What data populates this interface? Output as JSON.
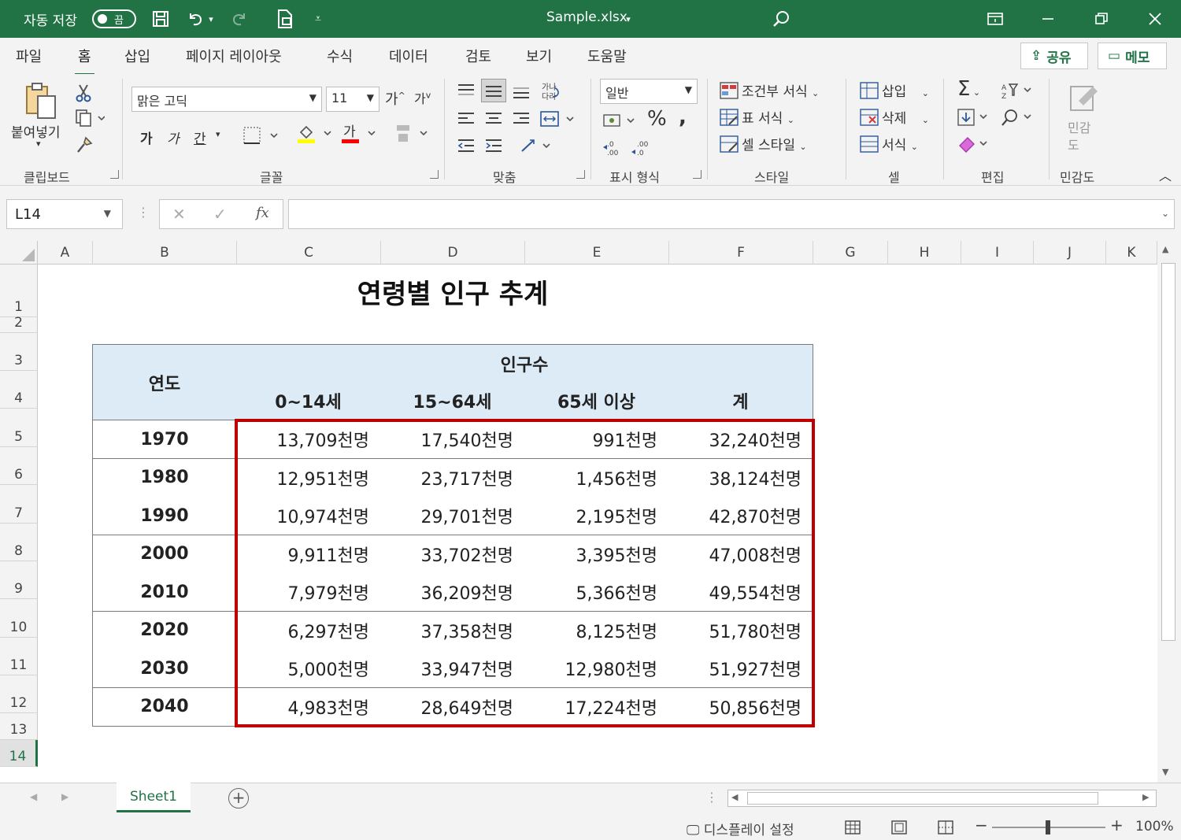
{
  "titlebar": {
    "autosave_label": "자동 저장",
    "autosave_state": "끔",
    "filename": "Sample.xlsx",
    "accent": "#217346"
  },
  "menu": {
    "tabs": [
      "파일",
      "홈",
      "삽입",
      "페이지 레이아웃",
      "수식",
      "데이터",
      "검토",
      "보기",
      "도움말"
    ],
    "active": "홈",
    "share": "공유",
    "memo": "메모"
  },
  "ribbon": {
    "clipboard": {
      "paste": "붙여넣기",
      "label": "클립보드"
    },
    "font": {
      "name": "맑은 고딕",
      "size": "11",
      "grow": "가",
      "shrink": "가",
      "bold": "가",
      "italic": "가",
      "underline": "간",
      "label": "글꼴",
      "fill_color": "#ffff00",
      "font_color": "#ff0000"
    },
    "alignment": {
      "label": "맞춤"
    },
    "number": {
      "format": "일반",
      "label": "표시 형식"
    },
    "styles": {
      "conditional": "조건부 서식",
      "table": "표 서식",
      "cell": "셀 스타일",
      "label": "스타일"
    },
    "cells": {
      "insert": "삽입",
      "delete": "삭제",
      "format": "서식",
      "label": "셀"
    },
    "editing": {
      "label": "편집"
    },
    "sensitivity": {
      "button": "민감도",
      "label": "민감도"
    }
  },
  "formula_bar": {
    "name_box": "L14",
    "fx": "fx",
    "value": ""
  },
  "grid": {
    "columns": [
      "A",
      "B",
      "C",
      "D",
      "E",
      "F",
      "G",
      "H",
      "I",
      "J",
      "K"
    ],
    "rows": [
      "1",
      "2",
      "3",
      "4",
      "5",
      "6",
      "7",
      "8",
      "9",
      "10",
      "11",
      "12",
      "13",
      "14"
    ],
    "selected_row": "14"
  },
  "sheet": {
    "title": "연령별 인구 추계",
    "header_year": "연도",
    "header_pop": "인구수",
    "sub_headers": [
      "0~14세",
      "15~64세",
      "65세 이상",
      "계"
    ],
    "rows": [
      {
        "year": "1970",
        "values": [
          "13,709천명",
          "17,540천명",
          "991천명",
          "32,240천명"
        ]
      },
      {
        "year": "1980",
        "values": [
          "12,951천명",
          "23,717천명",
          "1,456천명",
          "38,124천명"
        ]
      },
      {
        "year": "1990",
        "values": [
          "10,974천명",
          "29,701천명",
          "2,195천명",
          "42,870천명"
        ]
      },
      {
        "year": "2000",
        "values": [
          "9,911천명",
          "33,702천명",
          "3,395천명",
          "47,008천명"
        ]
      },
      {
        "year": "2010",
        "values": [
          "7,979천명",
          "36,209천명",
          "5,366천명",
          "49,554천명"
        ]
      },
      {
        "year": "2020",
        "values": [
          "6,297천명",
          "37,358천명",
          "8,125천명",
          "51,780천명"
        ]
      },
      {
        "year": "2030",
        "values": [
          "5,000천명",
          "33,947천명",
          "12,980천명",
          "51,927천명"
        ]
      },
      {
        "year": "2040",
        "values": [
          "4,983천명",
          "28,649천명",
          "17,224천명",
          "50,856천명"
        ]
      }
    ],
    "header_fill": "#ddebf7",
    "highlight_color": "#c00000"
  },
  "sheet_tabs": {
    "active": "Sheet1"
  },
  "status": {
    "display_settings": "디스플레이 설정",
    "zoom": "100%"
  }
}
